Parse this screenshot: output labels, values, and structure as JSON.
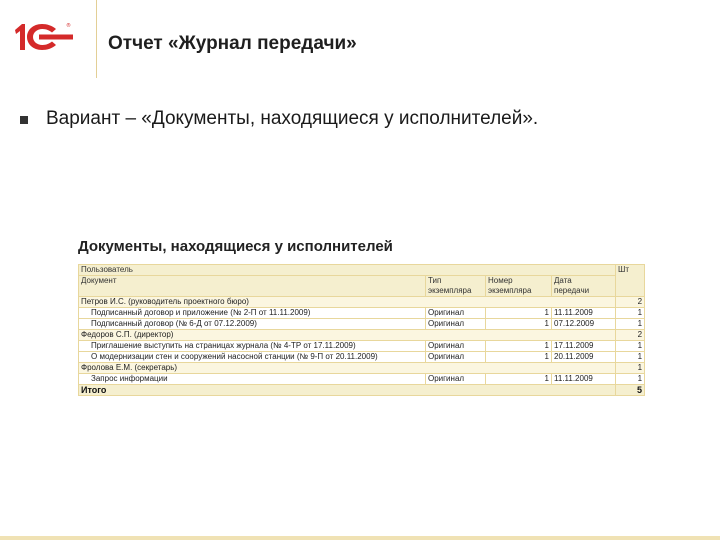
{
  "header": {
    "title": "Отчет «Журнал передачи»"
  },
  "content": {
    "bullet": "Вариант – «Документы, находящиеся у исполнителей»."
  },
  "report": {
    "title": "Документы, находящиеся у исполнителей",
    "columns": {
      "user": "Пользователь",
      "document": "Документ",
      "type_line1": "Тип",
      "type_line2": "экземпляра",
      "number_line1": "Номер",
      "number_line2": "экземпляра",
      "date_line1": "Дата",
      "date_line2": "передачи",
      "count": "Шт"
    },
    "groups": [
      {
        "user": "Петров И.С. (руководитель проектного бюро)",
        "count": "2",
        "rows": [
          {
            "document": "Подписанный договор и приложение (№ 2-П от 11.11.2009)",
            "type": "Оригинал",
            "number": "1",
            "date": "11.11.2009",
            "count": "1"
          },
          {
            "document": "Подписанный договор (№ 6-Д от 07.12.2009)",
            "type": "Оригинал",
            "number": "1",
            "date": "07.12.2009",
            "count": "1"
          }
        ]
      },
      {
        "user": "Федоров С.П. (директор)",
        "count": "2",
        "rows": [
          {
            "document": "Приглашение выступить на страницах журнала (№ 4-ТР от 17.11.2009)",
            "type": "Оригинал",
            "number": "1",
            "date": "17.11.2009",
            "count": "1"
          },
          {
            "document": "О модернизации стен и сооружений насосной станции (№ 9-П от 20.11.2009)",
            "type": "Оригинал",
            "number": "1",
            "date": "20.11.2009",
            "count": "1"
          }
        ]
      },
      {
        "user": "Фролова Е.М. (секретарь)",
        "count": "1",
        "rows": [
          {
            "document": "Запрос информации",
            "type": "Оригинал",
            "number": "1",
            "date": "11.11.2009",
            "count": "1"
          }
        ]
      }
    ],
    "total_label": "Итого",
    "total_count": "5"
  }
}
